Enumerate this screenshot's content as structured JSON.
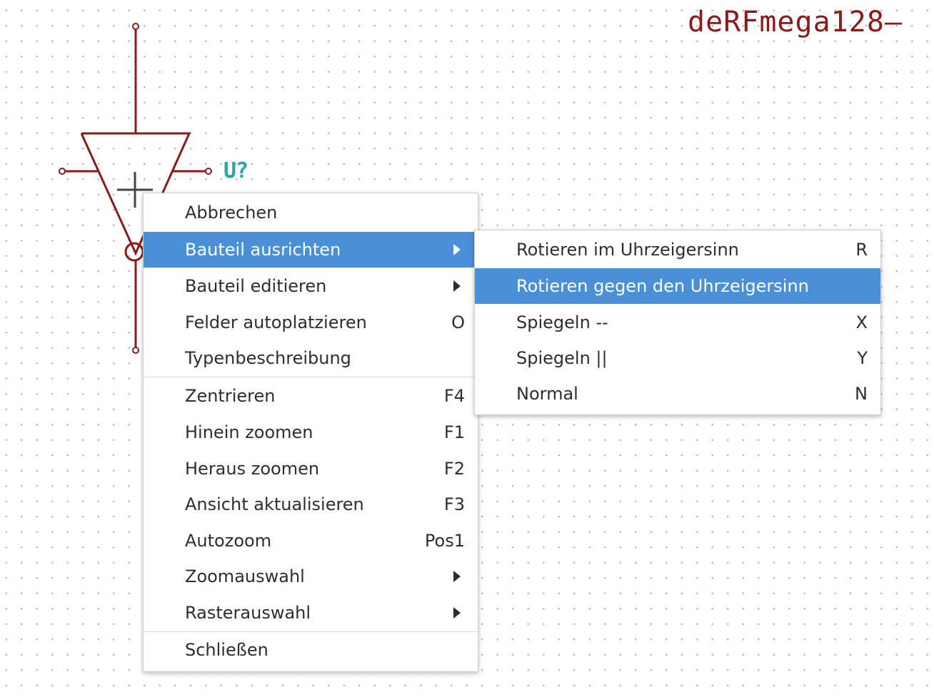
{
  "sheet": {
    "title": "deRFmega128–",
    "reference": "U?"
  },
  "context_menu": {
    "items": [
      {
        "label": "Abbrechen",
        "accel": ""
      },
      {
        "label": "Bauteil ausrichten",
        "accel": "",
        "submenu": true,
        "active": true
      },
      {
        "label": "Bauteil editieren",
        "accel": "",
        "submenu": true
      },
      {
        "label": "Felder autoplatzieren",
        "accel": "O"
      },
      {
        "label": "Typenbeschreibung",
        "accel": ""
      },
      {
        "label": "Zentrieren",
        "accel": "F4"
      },
      {
        "label": "Hinein zoomen",
        "accel": "F1"
      },
      {
        "label": "Heraus zoomen",
        "accel": "F2"
      },
      {
        "label": "Ansicht aktualisieren",
        "accel": "F3"
      },
      {
        "label": "Autozoom",
        "accel": "Pos1"
      },
      {
        "label": "Zoomauswahl",
        "accel": "",
        "submenu": true
      },
      {
        "label": "Rasterauswahl",
        "accel": "",
        "submenu": true
      },
      {
        "label": "Schließen",
        "accel": ""
      }
    ]
  },
  "orient_submenu": {
    "items": [
      {
        "label": "Rotieren im Uhrzeigersinn",
        "accel": "R"
      },
      {
        "label": "Rotieren gegen den Uhrzeigersinn",
        "accel": "",
        "active": true
      },
      {
        "label": "Spiegeln --",
        "accel": "X"
      },
      {
        "label": "Spiegeln ||",
        "accel": "Y"
      },
      {
        "label": "Normal",
        "accel": "N"
      }
    ]
  },
  "colors": {
    "wire": "#8b1a1a",
    "reference": "#2aa5a5",
    "highlight": "#4a90d9"
  }
}
